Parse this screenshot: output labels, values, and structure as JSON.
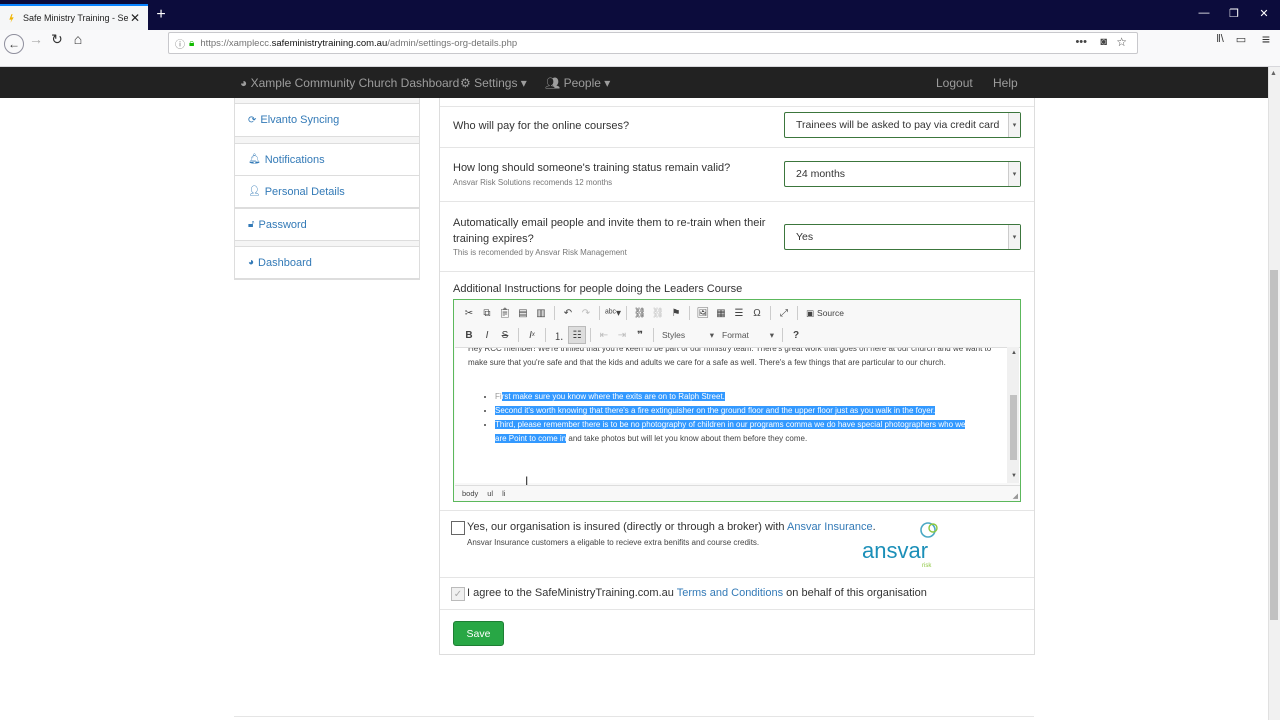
{
  "browser": {
    "tab_title": "Safe Ministry Training - Setting",
    "url_prefix": "https://xamplecc.",
    "url_domain": "safeministrytraining.com.au",
    "url_path": "/admin/settings-org-details.php"
  },
  "topnav": {
    "dashboard": "Xample Community Church Dashboard",
    "settings": "Settings",
    "people": "People",
    "logout": "Logout",
    "help": "Help"
  },
  "sidebar": {
    "items": [
      {
        "label": "Elvanto Syncing",
        "icon": "refresh-icon"
      },
      {
        "label": "Notifications",
        "icon": "bell-icon"
      },
      {
        "label": "Personal Details",
        "icon": "user-icon"
      },
      {
        "label": "Password",
        "icon": "unlock-icon"
      },
      {
        "label": "Dashboard",
        "icon": "dashboard-icon"
      }
    ]
  },
  "form": {
    "pay_question": "Who will pay for the online courses?",
    "pay_value": "Trainees will be asked to pay via credit card",
    "valid_question": "How long should someone's training status remain valid?",
    "valid_hint": "Ansvar Risk Solutions recomends 12 months",
    "valid_value": "24 months",
    "email_question_1": "Automatically email people and invite them to re-train when their",
    "email_question_2": "training expires?",
    "email_hint": "This is recomended by Ansvar Risk Management",
    "email_value": "Yes",
    "instructions_label": "Additional Instructions for people doing the Leaders Course"
  },
  "editor": {
    "source_label": "Source",
    "styles_label": "Styles",
    "format_label": "Format",
    "para": "Hey RCC member! We're thrilled that you're keen to be part of our ministry team. There's great work that goes on here at our church and we want to make sure that you're safe and that the kids and adults we care for a safe as well. There's a few things that are particular to our church.",
    "bullet1_pre": "Fi",
    "bullet1_sel": "rst make sure you know where the exits are on to Ralph Street.",
    "bullet2_sel": "Second it's worth knowing that there's a fire extinguisher on the ground floor and the upper floor just as you walk in the foyer.",
    "bullet3_sel": "Third, please remember there is to be no photography of children in our programs comma we do have special photographers who we are Point to come in",
    "bullet3_post": " and take photos but will let you know about them before they come.",
    "path": [
      "body",
      "ul",
      "li"
    ]
  },
  "insurance": {
    "label_pre": "Yes, our organisation is insured (directly or through a broker) with ",
    "label_link": "Ansvar Insurance",
    "label_post": ".",
    "sub": "Ansvar Insurance customers a eligable to recieve extra benifits and course credits.",
    "logo_text": "ansvar",
    "logo_sub": "risk"
  },
  "terms": {
    "label_pre": "I agree to the SafeMinistryTraining.com.au ",
    "label_link": "Terms and Conditions",
    "label_post": " on behalf of this organisation"
  },
  "save_label": "Save",
  "colors": {
    "accent": "#337ab7",
    "success": "#28a745",
    "navbar": "#222222",
    "selection": "#3399ff"
  }
}
